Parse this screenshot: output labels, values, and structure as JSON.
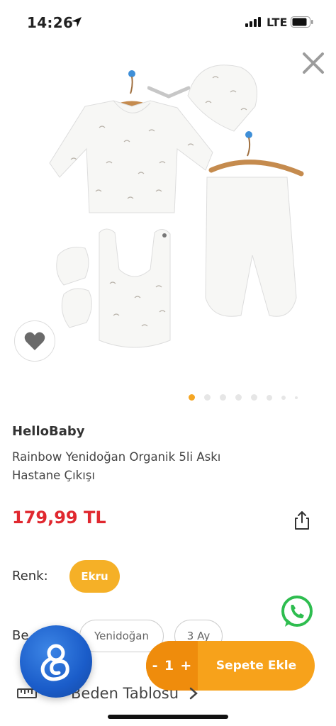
{
  "status_bar": {
    "time": "14:26",
    "network": "LTE"
  },
  "product": {
    "brand": "HelloBaby",
    "title": "Rainbow Yenidoğan Organik 5li Askı Hastane Çıkışı",
    "price": "179,99 TL",
    "image_count": 8,
    "active_image_index": 0
  },
  "color": {
    "label": "Renk:",
    "selected": "Ekru"
  },
  "size": {
    "label": "Be",
    "options": [
      "Yenidoğan",
      "3 Ay"
    ]
  },
  "cart": {
    "minus": "-",
    "quantity": "1",
    "plus": "+",
    "add_label": "Sepete Ekle"
  },
  "size_table": {
    "label": "Beden Tablosu"
  },
  "colors": {
    "accent": "#f5a623",
    "price": "#e0282f",
    "cart": "#f7a21b",
    "cart_qty": "#ef8c0c"
  }
}
